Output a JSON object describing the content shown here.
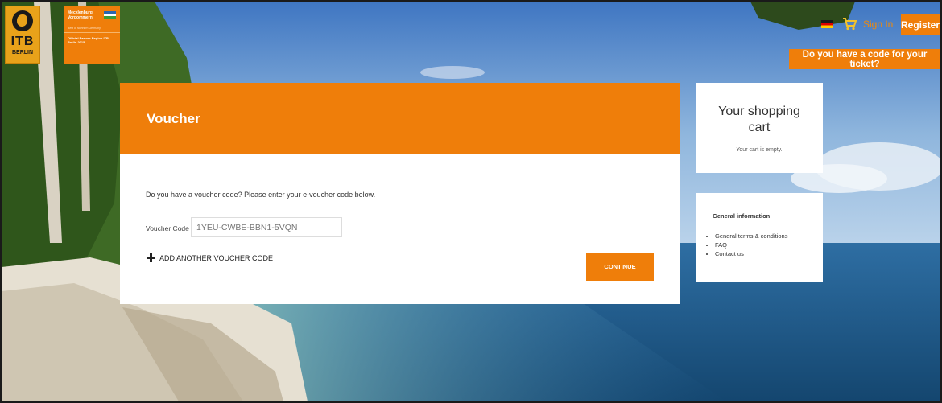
{
  "header": {
    "itb_logo_text": "ITB",
    "itb_logo_sub": "BERLIN",
    "partner_logo_name": "Mecklenburg Vorpommern",
    "partner_logo_tagline": "Best of Northern Germany",
    "partner_logo_caption": "Official Partner Region ITB Berlin 2015",
    "signin_label": "Sign In",
    "register_label": "Register",
    "code_question_label": "Do you have a code for your ticket?"
  },
  "voucher": {
    "title": "Voucher",
    "instructions": "Do you have a voucher code? Please enter your e-voucher code below.",
    "code_label": "Voucher Code",
    "code_value": "1YEU-CWBE-BBN1-5VQN",
    "add_another_label": "ADD ANOTHER VOUCHER CODE",
    "continue_label": "CONTINUE"
  },
  "cart": {
    "title": "Your shopping cart",
    "empty_text": "Your cart is empty."
  },
  "info": {
    "title": "General information",
    "links": [
      "General terms & conditions",
      "FAQ",
      "Contact us"
    ]
  },
  "colors": {
    "accent": "#ef7e0a"
  }
}
